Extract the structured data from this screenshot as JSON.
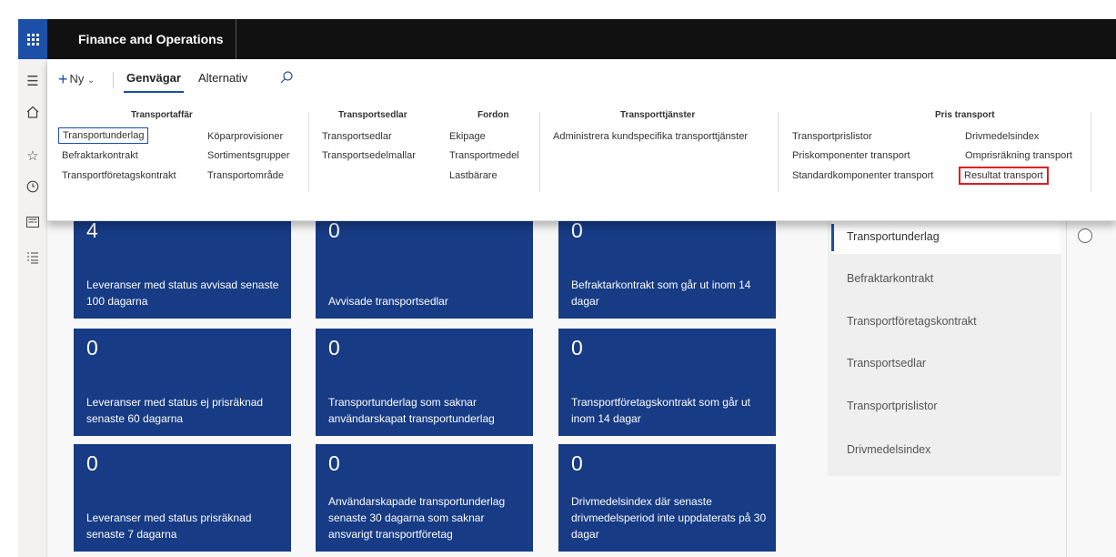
{
  "app": {
    "title": "Finance and Operations"
  },
  "action_pane": {
    "new_label": "Ny",
    "tabs": [
      {
        "label": "Genvägar",
        "active": true
      },
      {
        "label": "Alternativ",
        "active": false
      }
    ],
    "groups": {
      "transportaffar": {
        "title": "Transportaffär",
        "links": [
          "Transportunderlag",
          "Befraktarkontrakt",
          "Transportföretagskontrakt",
          "Köparprovisioner",
          "Sortimentsgrupper",
          "Transportområde"
        ]
      },
      "transportsedlar": {
        "title": "Transportsedlar",
        "links": [
          "Transportsedlar",
          "Transportsedelmallar"
        ]
      },
      "fordon": {
        "title": "Fordon",
        "links": [
          "Ekipage",
          "Transportmedel",
          "Lastbärare"
        ]
      },
      "transporttjanster": {
        "title": "Transporttjänster",
        "links": [
          "Administrera kundspecifika transporttjänster"
        ]
      },
      "pris_transport": {
        "title": "Pris transport",
        "links": [
          "Transportprislistor",
          "Priskomponenter transport",
          "Standardkomponenter transport",
          "Drivmedelsindex",
          "Omprisräkning transport",
          "Resultat transport"
        ]
      }
    }
  },
  "tiles": [
    {
      "count": "4",
      "label": "Leveranser med status avvisad senaste 100 dagarna"
    },
    {
      "count": "0",
      "label": "Avvisade transportsedlar"
    },
    {
      "count": "0",
      "label": "Befraktarkontrakt som går ut inom 14 dagar"
    },
    {
      "count": "0",
      "label": "Leveranser med status ej prisräknad senaste 60 dagarna"
    },
    {
      "count": "0",
      "label": "Transportunderlag som saknar användarskapat transportunderlag"
    },
    {
      "count": "0",
      "label": "Transportföretagskontrakt som går ut inom 14 dagar"
    },
    {
      "count": "0",
      "label": "Leveranser med status prisräknad senaste 7 dagarna"
    },
    {
      "count": "0",
      "label": "Användarskapade transportunderlag senaste 30 dagarna som saknar ansvarigt transportföretag"
    },
    {
      "count": "0",
      "label": "Drivmedelsindex där senaste drivmedelsperiod inte uppdaterats på 30 dagar"
    }
  ],
  "links_list": [
    "Transportunderlag",
    "Befraktarkontrakt",
    "Transportföretagskontrakt",
    "Transportsedlar",
    "Transportprislistor",
    "Drivmedelsindex"
  ],
  "colors": {
    "tile": "#173b85",
    "accent": "#1b4fa8",
    "highlight_red": "#e21b23"
  }
}
